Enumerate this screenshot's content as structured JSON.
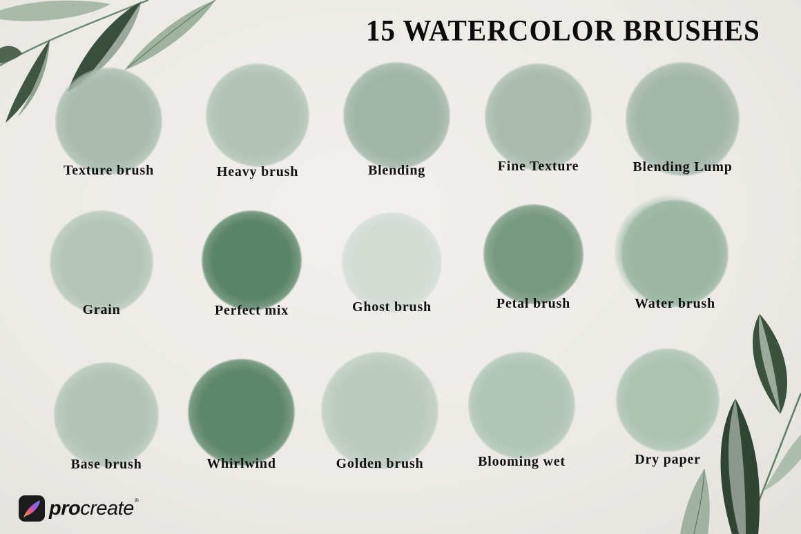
{
  "title": "15 WATERCOLOR BRUSHES",
  "brushes": [
    {
      "label": "Texture brush",
      "color": "#a9bcae"
    },
    {
      "label": "Heavy brush",
      "color": "#b0c3b4"
    },
    {
      "label": "Blending",
      "color": "#9fb5a6"
    },
    {
      "label": "Fine Texture",
      "color": "#a8bbad"
    },
    {
      "label": "Blending Lump",
      "color": "#a4b8aa"
    },
    {
      "label": "Grain",
      "color": "#b4c6b7"
    },
    {
      "label": "Perfect mix",
      "color": "#5a8466"
    },
    {
      "label": "Ghost brush",
      "color": "#d2dcd3"
    },
    {
      "label": "Petal brush",
      "color": "#77997f"
    },
    {
      "label": "Water brush",
      "color": "#9ab6a2"
    },
    {
      "label": "Base brush",
      "color": "#b2c5b7"
    },
    {
      "label": "Whirlwind",
      "color": "#5e8769"
    },
    {
      "label": "Golden brush",
      "color": "#bccbbf"
    },
    {
      "label": "Blooming wet",
      "color": "#afc5b6"
    },
    {
      "label": "Dry paper",
      "color": "#adc3b2"
    }
  ],
  "logo": {
    "brand_bold": "pro",
    "brand_light": "create",
    "registered": "®",
    "icon": "procreate-feather-icon"
  },
  "decor": {
    "icon_top_left": "leaf-branch-icon",
    "icon_bottom_right": "leaf-branch-icon"
  }
}
